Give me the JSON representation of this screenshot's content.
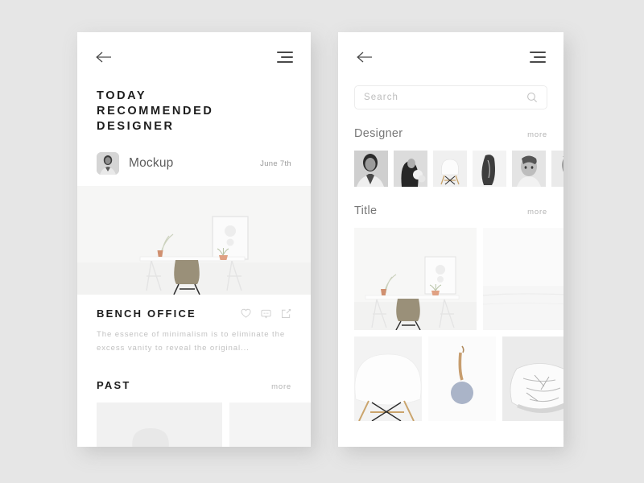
{
  "background_color": "#e6e6e6",
  "left_screen": {
    "topbar": {
      "back_icon": "arrow-left-icon",
      "menu_icon": "hamburger-menu-icon"
    },
    "page_title_lines": [
      "TODAY",
      "RECOMMENDED",
      "DESIGNER"
    ],
    "author": {
      "name": "Mockup",
      "date": "June 7th",
      "avatar_icon": "user-portrait-avatar"
    },
    "hero_image": "minimal-desk-with-olive-chair",
    "post": {
      "title": "BENCH OFFICE",
      "description": "The essence of minimalism is to eliminate the excess vanity to reveal the original...",
      "actions": [
        {
          "icon": "heart-icon",
          "name": "like"
        },
        {
          "icon": "comment-icon",
          "name": "comment"
        },
        {
          "icon": "share-icon",
          "name": "share"
        }
      ]
    },
    "past_section": {
      "title": "PAST",
      "more_label": "more",
      "tiles": [
        "white-chair-photo",
        "blank-white-photo"
      ]
    }
  },
  "right_screen": {
    "topbar": {
      "back_icon": "arrow-left-icon",
      "menu_icon": "hamburger-menu-icon"
    },
    "search": {
      "placeholder": "Search",
      "value": "",
      "icon": "search-icon"
    },
    "designer_section": {
      "title": "Designer",
      "more_label": "more",
      "thumbnails": [
        "portrait-man-bw",
        "woman-long-hair-flowers-bw",
        "white-eames-chair",
        "figure-in-white-drape",
        "woman-portrait-bw",
        "bearded-man-portrait"
      ]
    },
    "title_section": {
      "title": "Title",
      "more_label": "more",
      "gallery": {
        "row1": [
          "minimal-desk-with-olive-chair",
          "lone-figure-snow-landscape"
        ],
        "row2": [
          "white-chair-closeup",
          "blue-pendant-wall-clock",
          "marble-pattern-pillow"
        ]
      }
    }
  },
  "colors": {
    "card": "#ffffff",
    "title_dark": "#1d1d1d",
    "text_muted": "#9a9a9a",
    "text_light": "#c2c2c2",
    "heading_gray": "#777777",
    "chair_olive": "#9a9079",
    "clock_blue": "#aab4c8"
  }
}
